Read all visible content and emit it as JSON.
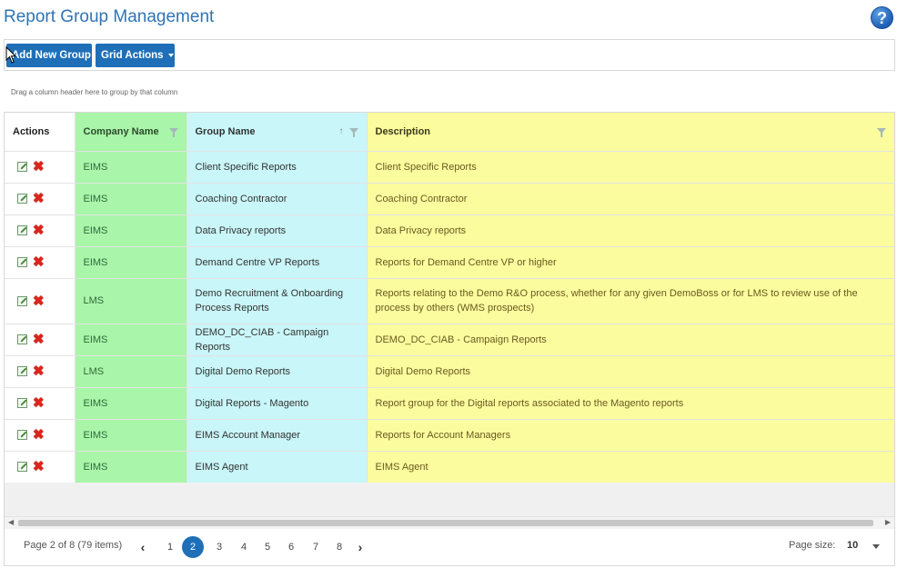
{
  "page": {
    "title": "Report Group Management",
    "help_label": "?"
  },
  "toolbar": {
    "add_label": "Add New Group",
    "grid_actions_label": "Grid Actions"
  },
  "group_hint": "Drag a column header here to group by that column",
  "columns": {
    "actions": "Actions",
    "company": "Company Name",
    "group": "Group Name",
    "description": "Description"
  },
  "rows": [
    {
      "company": "EIMS",
      "group": "Client Specific Reports",
      "description": "Client Specific Reports"
    },
    {
      "company": "EIMS",
      "group": "Coaching Contractor",
      "description": "Coaching Contractor"
    },
    {
      "company": "EIMS",
      "group": "Data Privacy reports",
      "description": "Data Privacy reports"
    },
    {
      "company": "EIMS",
      "group": "Demand Centre VP Reports",
      "description": "Reports for Demand Centre VP or higher"
    },
    {
      "company": "LMS",
      "group": "Demo Recruitment & Onboarding Process Reports",
      "description": "Reports relating to the Demo R&O process, whether for any given DemoBoss or for LMS to review use of the process by others (WMS prospects)"
    },
    {
      "company": "EIMS",
      "group": "DEMO_DC_CIAB - Campaign Reports",
      "description": "DEMO_DC_CIAB - Campaign Reports"
    },
    {
      "company": "LMS",
      "group": "Digital Demo Reports",
      "description": "Digital Demo Reports"
    },
    {
      "company": "EIMS",
      "group": "Digital Reports - Magento",
      "description": "Report group for the Digital reports associated to the Magento reports"
    },
    {
      "company": "EIMS",
      "group": "EIMS Account Manager",
      "description": "Reports for Account Managers"
    },
    {
      "company": "EIMS",
      "group": "EIMS Agent",
      "description": "EIMS Agent"
    }
  ],
  "pager": {
    "info": "Page 2 of 8 (79 items)",
    "prev": "‹",
    "next": "›",
    "pages": [
      "1",
      "2",
      "3",
      "4",
      "5",
      "6",
      "7",
      "8"
    ],
    "current_page": "2",
    "page_size_label": "Page size:",
    "page_size_value": "10"
  },
  "colors": {
    "accent": "#1e6fb8",
    "company_col": "#a9f5a9",
    "group_col": "#c9f6f8",
    "description_col": "#fbfc9e"
  },
  "icons": {
    "help": "help-icon",
    "edit": "edit-icon",
    "delete": "delete-icon",
    "filter": "filter-icon",
    "sort": "sort-asc-icon"
  }
}
